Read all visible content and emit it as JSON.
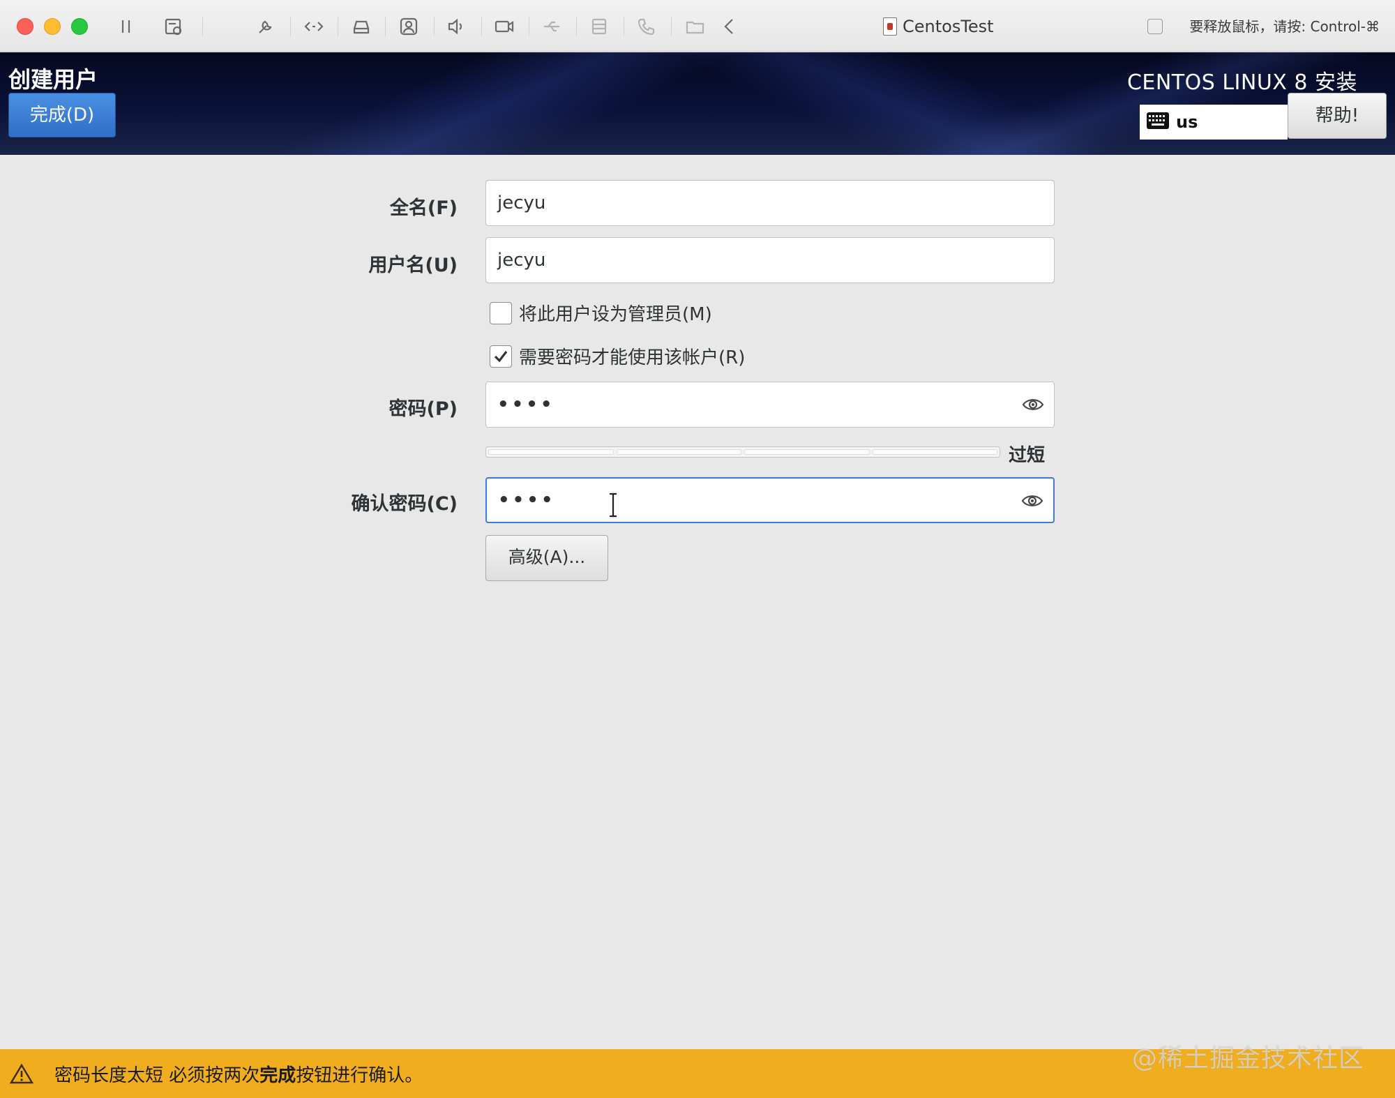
{
  "window": {
    "title": "CentosTest",
    "release_hint": "要释放鼠标，请按: Control-⌘"
  },
  "toolbar_icons": [
    "pause-icon",
    "snapshot-icon",
    "settings-wrench-icon",
    "code-icon",
    "disk-icon",
    "user-icon",
    "sound-icon",
    "camera-icon",
    "usb-icon",
    "list-icon",
    "phone-icon",
    "shared-folder-icon",
    "back-icon"
  ],
  "header": {
    "title": "创建用户",
    "done_label": "完成(D)",
    "product": "CENTOS LINUX 8 安装",
    "keyboard_layout": "us",
    "help_label": "帮助!"
  },
  "form": {
    "fullname_label": "全名(F)",
    "fullname_value": "jecyu",
    "username_label": "用户名(U)",
    "username_value": "jecyu",
    "admin_label": "将此用户设为管理员(M)",
    "admin_checked": false,
    "require_password_label": "需要密码才能使用该帐户(R)",
    "require_password_checked": true,
    "password_label": "密码(P)",
    "password_value": "••••",
    "strength_label": "过短",
    "strength_level": 0,
    "confirm_label": "确认密码(C)",
    "confirm_value": "••••",
    "advanced_label": "高级(A)..."
  },
  "warning": {
    "text_before": "密码长度太短 必须按两次",
    "text_bold": "完成",
    "text_after": "按钮进行确认。"
  },
  "watermark": "@稀土掘金技术社区",
  "colors": {
    "accent_blue": "#3b7ad9",
    "warning_yellow": "#f0ae1e",
    "header_dark": "#0a1138"
  }
}
